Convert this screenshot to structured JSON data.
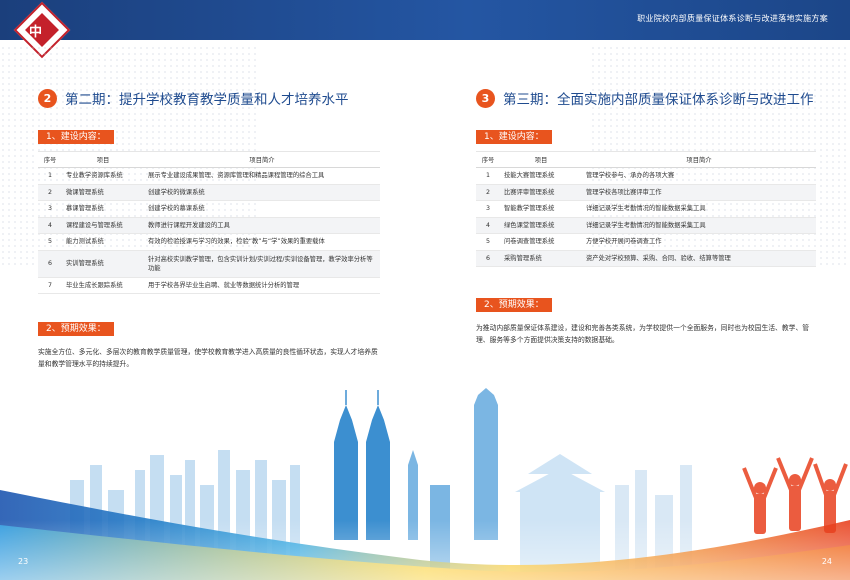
{
  "header": {
    "title": "职业院校内部质量保证体系诊断与改进落地实施方案",
    "logo_text": "中"
  },
  "left": {
    "number": "2",
    "title": "第二期：提升学校教育教学质量和人才培养水平",
    "tag1": "1、建设内容：",
    "table": {
      "headers": [
        "序号",
        "项目",
        "项目简介"
      ],
      "rows": [
        {
          "no": "1",
          "name": "专业教学资源库系统",
          "desc": "展示专业建设成果管理、资源库管理和精品课程管理的综合工具"
        },
        {
          "no": "2",
          "name": "微课管理系统",
          "desc": "创建学校的微课系统"
        },
        {
          "no": "3",
          "name": "慕课管理系统",
          "desc": "创建学校的慕课系统"
        },
        {
          "no": "4",
          "name": "课程建设与管理系统",
          "desc": "教师进行课程开发建设的工具"
        },
        {
          "no": "5",
          "name": "能力测试系统",
          "desc": "有效的检验授课与学习的效果，检验“教”与“学”效果的重要载体"
        },
        {
          "no": "6",
          "name": "实训管理系统",
          "desc": "针对高校实训教学管理，包含实训计划/实训过程/实训设备管理，教学效率分析等功能"
        },
        {
          "no": "7",
          "name": "毕业生成长跟踪系统",
          "desc": "用于学校各界毕业生启聘、就业等数据统计分析的管理"
        }
      ]
    },
    "tag2": "2、预期效果：",
    "effect": "实施全方位、多元化、多层次的教育教学质量管理，使学校教育教学进入高质量的良性循环状态，实现人才培养质量和教学管理水平的持续提升。",
    "page": "23"
  },
  "right": {
    "number": "3",
    "title": "第三期：全面实施内部质量保证体系诊断与改进工作",
    "tag1": "1、建设内容：",
    "table": {
      "headers": [
        "序号",
        "项目",
        "项目简介"
      ],
      "rows": [
        {
          "no": "1",
          "name": "技能大赛管理系统",
          "desc": "管理学校参与、承办的各项大赛"
        },
        {
          "no": "2",
          "name": "比赛评审管理系统",
          "desc": "管理学校各项比赛评审工作"
        },
        {
          "no": "3",
          "name": "智能教学管理系统",
          "desc": "详细记录学生考勤情况的智能数据采集工具"
        },
        {
          "no": "4",
          "name": "绿色课堂管理系统",
          "desc": "详细记录学生考勤情况的智能数据采集工具"
        },
        {
          "no": "5",
          "name": "问卷调查管理系统",
          "desc": "方便学校开展问卷调查工作"
        },
        {
          "no": "6",
          "name": "采购管理系统",
          "desc": "资产处对学校预算、采购、合同、验收、结算等管理"
        }
      ]
    },
    "tag2": "2、预期效果：",
    "effect": "为推动内部质量保证体系建设，建设和完善各类系统，为学校提供一个全面服务，同时也为校园生活、教学、管理、服务等多个方面提供决策支持的数据基础。",
    "page": "24"
  },
  "colors": {
    "navy": "#1f4b8f",
    "orange": "#e8541e",
    "red": "#c4212b"
  }
}
